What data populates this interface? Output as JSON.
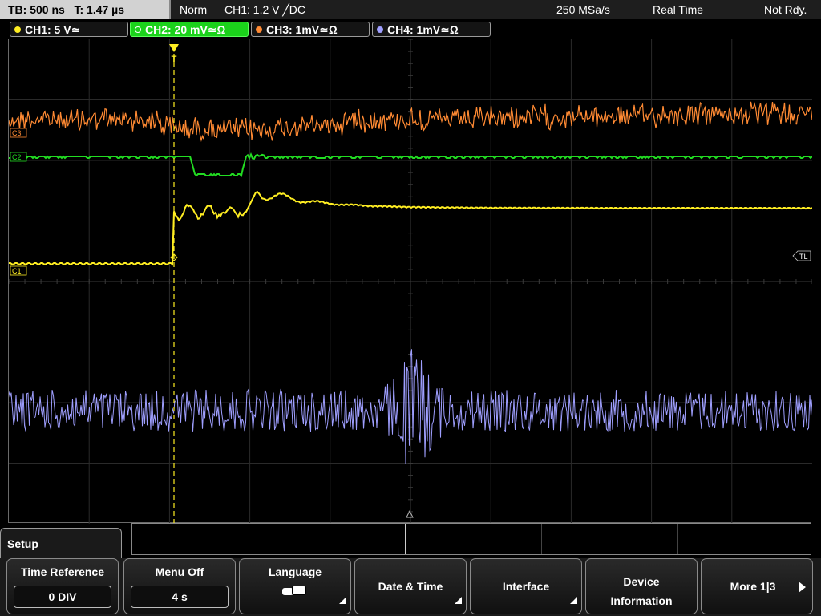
{
  "status_bar": {
    "timebase": "TB: 500 ns",
    "trigger_time": "T: 1.47 µs",
    "trigger_mode": "Norm",
    "trigger_setting": "CH1: 1.2 V ╱DC",
    "sample_rate": "250 MSa/s",
    "acquisition_mode": "Real Time",
    "status": "Not Rdy."
  },
  "channels": [
    {
      "label": "CH1: 5 V≃",
      "color": "#ffee22",
      "active": false
    },
    {
      "label": "CH2: 20 mV≃Ω",
      "color": "#22dd22",
      "active": true
    },
    {
      "label": "CH3: 1mV≃Ω",
      "color": "#ff8a33",
      "active": false
    },
    {
      "label": "CH4: 1mV≃Ω",
      "color": "#9f9fff",
      "active": false
    }
  ],
  "screen": {
    "markers": {
      "ch3": "C3",
      "ch2": "C2",
      "ch1": "C1",
      "trigger_level": "TL",
      "trigger_top": "T"
    },
    "trace_colors": {
      "ch1": "#ffee22",
      "ch2": "#22dd22",
      "ch3": "#ff8a33",
      "ch4": "#9f9fff"
    },
    "grid": true,
    "divisions": {
      "horizontal": 10,
      "vertical": 8
    }
  },
  "menu": {
    "title": "Setup",
    "softkeys": [
      {
        "label": "Time Reference",
        "value": "0 DIV"
      },
      {
        "label": "Menu Off",
        "value": "4 s"
      },
      {
        "label": "Language",
        "icon": "speech-bubbles-icon"
      },
      {
        "label": "Date & Time"
      },
      {
        "label": "Interface"
      },
      {
        "label": "Device",
        "label2": "Information"
      },
      {
        "label": "More 1|3",
        "icon": "arrow-right-icon"
      }
    ]
  }
}
